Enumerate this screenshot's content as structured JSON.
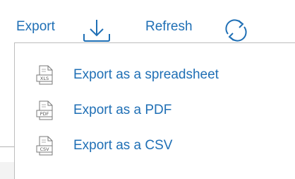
{
  "toolbar": {
    "export_label": "Export",
    "refresh_label": "Refresh",
    "export_icon": "download-icon",
    "refresh_icon": "refresh-icon"
  },
  "menu": {
    "items": [
      {
        "label": "Export as a spreadsheet",
        "icon": "xls-file-icon",
        "badge": "XLS"
      },
      {
        "label": "Export as a PDF",
        "icon": "pdf-file-icon",
        "badge": "PDF"
      },
      {
        "label": "Export as a CSV",
        "icon": "csv-file-icon",
        "badge": "CSV"
      }
    ]
  },
  "colors": {
    "accent": "#1f6fb5",
    "menu_border": "#bdbdbd",
    "icon_gray": "#7a7a7a"
  }
}
